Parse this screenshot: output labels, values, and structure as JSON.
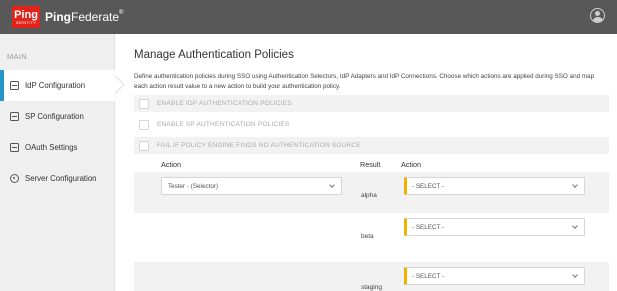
{
  "brand": {
    "badge": "Ping",
    "badge_sub": "IDENTITY",
    "name_bold": "Ping",
    "name_rest": "Federate",
    "tm": "®"
  },
  "sidebar": {
    "heading": "MAIN",
    "items": [
      {
        "label": "IdP Configuration",
        "active": true
      },
      {
        "label": "SP Configuration",
        "active": false
      },
      {
        "label": "OAuth Settings",
        "active": false
      },
      {
        "label": "Server Configuration",
        "active": false
      }
    ]
  },
  "main": {
    "title": "Manage Authentication Policies",
    "description": "Define authentication policies during SSO using Authentication Selectors, IdP Adapters and IdP Connections. Choose which actions are applied during SSO and map each action result value to a new action to build your authentication policy.",
    "checkboxes": [
      "ENABLE IDP AUTHENTICATION POLICIES",
      "ENABLE SP AUTHENTICATION POLICIES",
      "FAIL IF POLICY ENGINE FINDS NO AUTHENTICATION SOURCE"
    ],
    "table": {
      "col_action": "Action",
      "col_result": "Result",
      "col_result_action": "Action",
      "selected_action": "Tester - (Selector)",
      "rows": [
        {
          "result": "alpha",
          "action": "- SELECT -"
        },
        {
          "result": "beta",
          "action": "- SELECT -"
        },
        {
          "result": "staging",
          "action": "- SELECT -"
        }
      ]
    }
  },
  "colors": {
    "topbar": "#585858",
    "brand_red": "#e2231a",
    "active_accent": "#2694c6",
    "required_marker": "#f2b100"
  },
  "icons": {
    "user": "user-icon",
    "idp": "idp-icon",
    "sp": "sp-icon",
    "oauth": "oauth-icon",
    "server": "gear-icon"
  }
}
